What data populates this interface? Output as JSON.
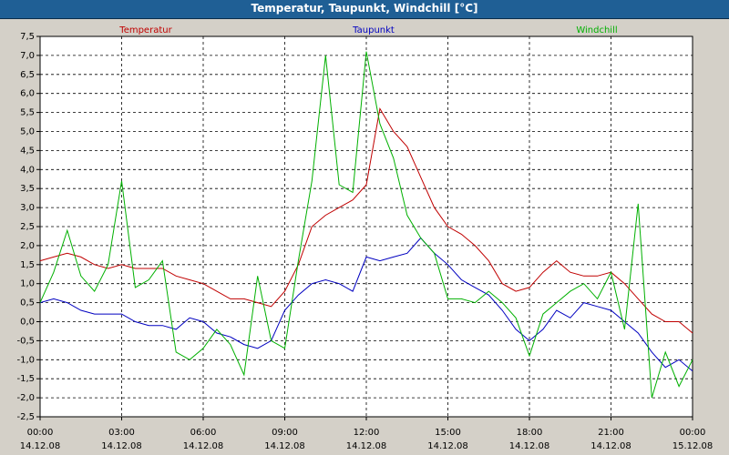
{
  "window": {
    "title": "Temperatur, Taupunkt, Windchill [°C]"
  },
  "chart_data": {
    "type": "line",
    "title": "Temperatur, Taupunkt, Windchill [°C]",
    "xlabel": "",
    "ylabel": "",
    "x_hours": [
      0,
      0.5,
      1,
      1.5,
      2,
      2.5,
      3,
      3.5,
      4,
      4.5,
      5,
      5.5,
      6,
      6.5,
      7,
      7.5,
      8,
      8.5,
      9,
      9.5,
      10,
      10.5,
      11,
      11.5,
      12,
      12.5,
      13,
      13.5,
      14,
      14.5,
      15,
      15.5,
      16,
      16.5,
      17,
      17.5,
      18,
      18.5,
      19,
      19.5,
      20,
      20.5,
      21,
      21.5,
      22,
      22.5,
      23,
      23.5,
      24
    ],
    "xlim": [
      0,
      24
    ],
    "ylim": [
      -2.5,
      7.5
    ],
    "x_ticks": [
      {
        "x": 0,
        "time": "00:00",
        "date": "14.12.08"
      },
      {
        "x": 3,
        "time": "03:00",
        "date": "14.12.08"
      },
      {
        "x": 6,
        "time": "06:00",
        "date": "14.12.08"
      },
      {
        "x": 9,
        "time": "09:00",
        "date": "14.12.08"
      },
      {
        "x": 12,
        "time": "12:00",
        "date": "14.12.08"
      },
      {
        "x": 15,
        "time": "15:00",
        "date": "14.12.08"
      },
      {
        "x": 18,
        "time": "18:00",
        "date": "14.12.08"
      },
      {
        "x": 21,
        "time": "21:00",
        "date": "14.12.08"
      },
      {
        "x": 24,
        "time": "00:00",
        "date": "15.12.08"
      }
    ],
    "y_ticks": [
      {
        "v": 7.5,
        "label": "7,5"
      },
      {
        "v": 7.0,
        "label": "7,0"
      },
      {
        "v": 6.5,
        "label": "6,5"
      },
      {
        "v": 6.0,
        "label": "6,0"
      },
      {
        "v": 5.5,
        "label": "5,5"
      },
      {
        "v": 5.0,
        "label": "5,0"
      },
      {
        "v": 4.5,
        "label": "4,5"
      },
      {
        "v": 4.0,
        "label": "4,0"
      },
      {
        "v": 3.5,
        "label": "3,5"
      },
      {
        "v": 3.0,
        "label": "3,0"
      },
      {
        "v": 2.5,
        "label": "2,5"
      },
      {
        "v": 2.0,
        "label": "2,0"
      },
      {
        "v": 1.5,
        "label": "1,5"
      },
      {
        "v": 1.0,
        "label": "1,0"
      },
      {
        "v": 0.5,
        "label": "0,5"
      },
      {
        "v": 0.0,
        "label": "0,0"
      },
      {
        "v": -0.5,
        "label": "-0,5"
      },
      {
        "v": -1.0,
        "label": "-1,0"
      },
      {
        "v": -1.5,
        "label": "-1,5"
      },
      {
        "v": -2.0,
        "label": "-2,0"
      },
      {
        "v": -2.5,
        "label": "-2,5"
      }
    ],
    "grid": true,
    "legend_position": "top",
    "series": [
      {
        "name": "Temperatur",
        "color": "#c00000",
        "values": [
          1.6,
          1.7,
          1.8,
          1.7,
          1.5,
          1.4,
          1.5,
          1.4,
          1.4,
          1.4,
          1.2,
          1.1,
          1.0,
          0.8,
          0.6,
          0.6,
          0.5,
          0.4,
          0.8,
          1.5,
          2.5,
          2.8,
          3.0,
          3.2,
          3.6,
          5.6,
          5.0,
          4.6,
          3.8,
          3.0,
          2.5,
          2.3,
          2.0,
          1.6,
          1.0,
          0.8,
          0.9,
          1.3,
          1.6,
          1.3,
          1.2,
          1.2,
          1.3,
          1.0,
          0.6,
          0.2,
          0.0,
          0.0,
          -0.3
        ]
      },
      {
        "name": "Taupunkt",
        "color": "#0000c0",
        "values": [
          0.5,
          0.6,
          0.5,
          0.3,
          0.2,
          0.2,
          0.2,
          0.0,
          -0.1,
          -0.1,
          -0.2,
          0.1,
          0.0,
          -0.3,
          -0.4,
          -0.6,
          -0.7,
          -0.5,
          0.3,
          0.7,
          1.0,
          1.1,
          1.0,
          0.8,
          1.7,
          1.6,
          1.7,
          1.8,
          2.2,
          1.8,
          1.5,
          1.1,
          0.9,
          0.7,
          0.3,
          -0.2,
          -0.5,
          -0.2,
          0.3,
          0.1,
          0.5,
          0.4,
          0.3,
          0.0,
          -0.3,
          -0.8,
          -1.2,
          -1.0,
          -1.3
        ]
      },
      {
        "name": "Windchill",
        "color": "#00b000",
        "values": [
          0.5,
          1.3,
          2.4,
          1.2,
          0.8,
          1.5,
          3.7,
          0.9,
          1.1,
          1.6,
          -0.8,
          -1.0,
          -0.7,
          -0.2,
          -0.6,
          -1.4,
          1.2,
          -0.5,
          -0.7,
          1.6,
          3.7,
          7.0,
          3.6,
          3.4,
          7.1,
          5.2,
          4.3,
          2.8,
          2.2,
          1.8,
          0.6,
          0.6,
          0.5,
          0.8,
          0.5,
          0.1,
          -0.9,
          0.2,
          0.5,
          0.8,
          1.0,
          0.6,
          1.3,
          -0.2,
          3.1,
          -2.0,
          -0.8,
          -1.7,
          -1.0
        ]
      }
    ]
  }
}
